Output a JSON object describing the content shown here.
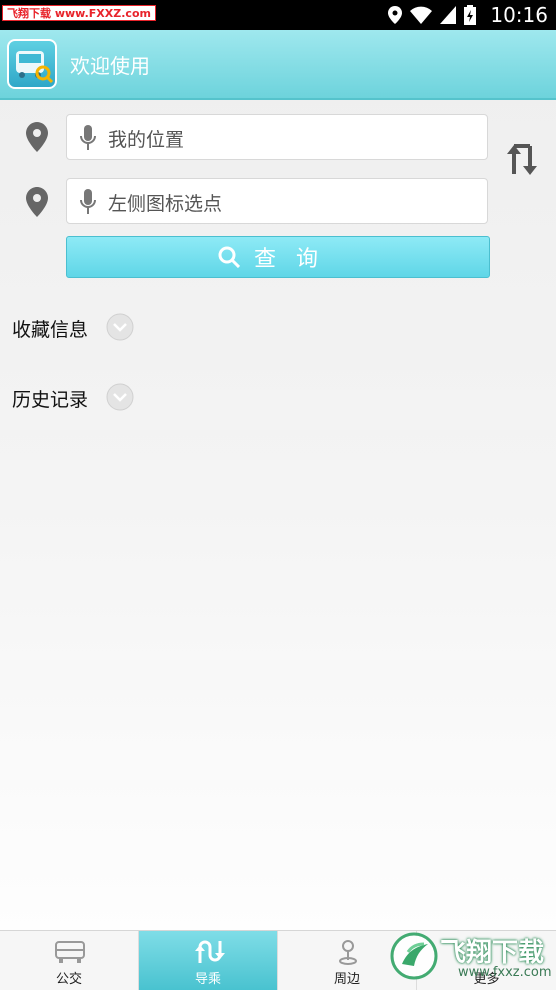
{
  "status_bar": {
    "watermark": "飞翔下载 www.FXXZ.com",
    "time": "10:16"
  },
  "header": {
    "title": "欢迎使用"
  },
  "search": {
    "start_placeholder": "我的位置",
    "end_placeholder": "左侧图标选点",
    "query_label": "查询"
  },
  "sections": {
    "favorites": "收藏信息",
    "history": "历史记录"
  },
  "bottom_nav": {
    "items": [
      {
        "label": "公交",
        "icon": "bus-icon"
      },
      {
        "label": "导乘",
        "icon": "route-icon"
      },
      {
        "label": "周边",
        "icon": "nearby-pin-icon"
      },
      {
        "label": "更多",
        "icon": "more-icon"
      }
    ],
    "active_index": 1
  },
  "watermark_bottom": {
    "line1": "飞翔下载",
    "line2": "www.fxxz.com"
  },
  "colors": {
    "accent": "#6dd3dc",
    "button": "#5fd6e7",
    "status_bar": "#000000"
  }
}
